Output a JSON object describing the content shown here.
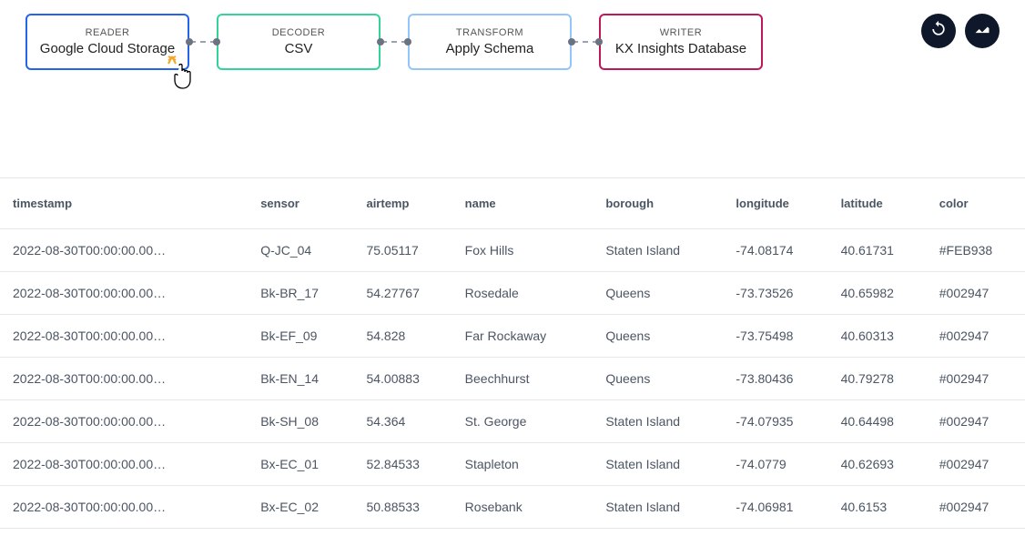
{
  "pipeline": {
    "nodes": [
      {
        "type": "READER",
        "title": "Google Cloud Storage",
        "cls": "reader"
      },
      {
        "type": "DECODER",
        "title": "CSV",
        "cls": "decoder"
      },
      {
        "type": "TRANSFORM",
        "title": "Apply Schema",
        "cls": "transform"
      },
      {
        "type": "WRITER",
        "title": "KX Insights Database",
        "cls": "writer"
      }
    ]
  },
  "actions": {
    "refresh_icon": "refresh-icon",
    "chart_icon": "trend-icon"
  },
  "table": {
    "columns": [
      "timestamp",
      "sensor",
      "airtemp",
      "name",
      "borough",
      "longitude",
      "latitude",
      "color"
    ],
    "rows": [
      {
        "timestamp": "2022-08-30T00:00:00.00…",
        "sensor": "Q-JC_04",
        "airtemp": "75.05117",
        "name": "Fox Hills",
        "borough": "Staten Island",
        "longitude": "-74.08174",
        "latitude": "40.61731",
        "color": "#FEB938"
      },
      {
        "timestamp": "2022-08-30T00:00:00.00…",
        "sensor": "Bk-BR_17",
        "airtemp": "54.27767",
        "name": "Rosedale",
        "borough": "Queens",
        "longitude": "-73.73526",
        "latitude": "40.65982",
        "color": "#002947"
      },
      {
        "timestamp": "2022-08-30T00:00:00.00…",
        "sensor": "Bk-EF_09",
        "airtemp": "54.828",
        "name": "Far Rockaway",
        "borough": "Queens",
        "longitude": "-73.75498",
        "latitude": "40.60313",
        "color": "#002947"
      },
      {
        "timestamp": "2022-08-30T00:00:00.00…",
        "sensor": "Bk-EN_14",
        "airtemp": "54.00883",
        "name": "Beechhurst",
        "borough": "Queens",
        "longitude": "-73.80436",
        "latitude": "40.79278",
        "color": "#002947"
      },
      {
        "timestamp": "2022-08-30T00:00:00.00…",
        "sensor": "Bk-SH_08",
        "airtemp": "54.364",
        "name": "St. George",
        "borough": "Staten Island",
        "longitude": "-74.07935",
        "latitude": "40.64498",
        "color": "#002947"
      },
      {
        "timestamp": "2022-08-30T00:00:00.00…",
        "sensor": "Bx-EC_01",
        "airtemp": "52.84533",
        "name": "Stapleton",
        "borough": "Staten Island",
        "longitude": "-74.0779",
        "latitude": "40.62693",
        "color": "#002947"
      },
      {
        "timestamp": "2022-08-30T00:00:00.00…",
        "sensor": "Bx-EC_02",
        "airtemp": "50.88533",
        "name": "Rosebank",
        "borough": "Staten Island",
        "longitude": "-74.06981",
        "latitude": "40.6153",
        "color": "#002947"
      }
    ]
  }
}
